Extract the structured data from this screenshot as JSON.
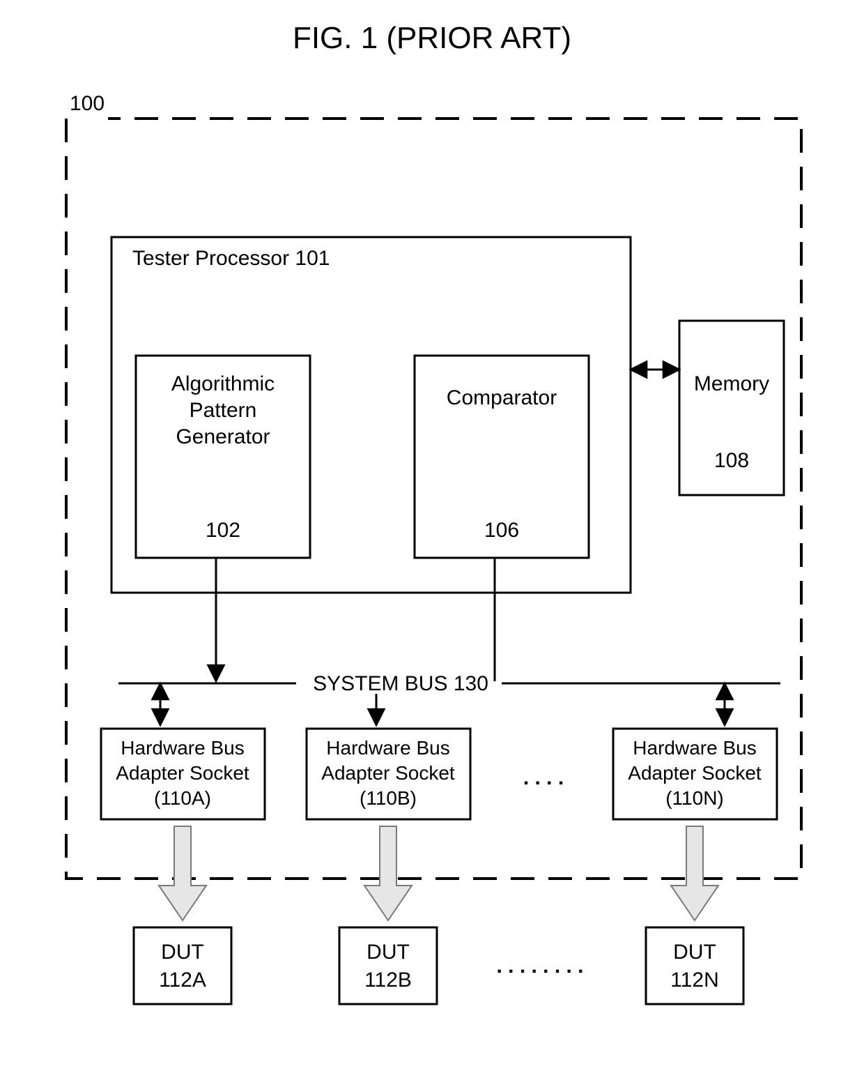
{
  "figure_title": "FIG. 1  (PRIOR ART)",
  "system_ref": "100",
  "blocks": {
    "tester_processor": {
      "label": "Tester Processor",
      "ref": "101"
    },
    "pattern_gen": {
      "line1": "Algorithmic",
      "line2": "Pattern",
      "line3": "Generator",
      "ref": "102"
    },
    "comparator": {
      "label": "Comparator",
      "ref": "106"
    },
    "memory": {
      "label": "Memory",
      "ref": "108"
    },
    "bus": {
      "label": "SYSTEM BUS",
      "ref": "130"
    },
    "hba": {
      "line1": "Hardware Bus",
      "line2": "Adapter Socket"
    },
    "hba_a": {
      "ref": "(110A)"
    },
    "hba_b": {
      "ref": "(110B)"
    },
    "hba_n": {
      "ref": "(110N)"
    },
    "dut": {
      "label": "DUT"
    },
    "dut_a": {
      "ref": "112A"
    },
    "dut_b": {
      "ref": "112B"
    },
    "dut_n": {
      "ref": "112N"
    },
    "ellipsis_items": ". . . .",
    "ellipsis_dut": ". . . . . . . ."
  }
}
